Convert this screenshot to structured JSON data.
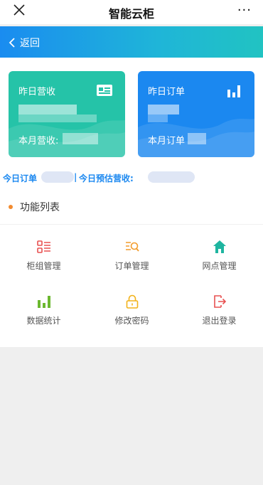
{
  "app": {
    "title": "智能云柜",
    "more": "···"
  },
  "nav": {
    "back_label": "返回"
  },
  "cards": [
    {
      "label": "昨日营收",
      "month_label": "本月营收:"
    },
    {
      "label": "昨日订单",
      "month_label": "本月订单"
    }
  ],
  "summary": {
    "today_orders_label": "今日订单",
    "separator": "|",
    "today_revenue_label": "今日预估营收:"
  },
  "section": {
    "title": "功能列表"
  },
  "menu": [
    {
      "label": "柜组管理",
      "icon": "list-icon",
      "color": "#e85050"
    },
    {
      "label": "订单管理",
      "icon": "search-list-icon",
      "color": "#f39c2b"
    },
    {
      "label": "网点管理",
      "icon": "home-icon",
      "color": "#1fb5a0"
    },
    {
      "label": "数据统计",
      "icon": "bar-chart-icon",
      "color": "#6bb82f"
    },
    {
      "label": "修改密码",
      "icon": "lock-icon",
      "color": "#f2b21a"
    },
    {
      "label": "退出登录",
      "icon": "logout-icon",
      "color": "#e85050"
    }
  ],
  "colors": {
    "green_card": "#25c3a8",
    "blue_card": "#1b88f0",
    "accent": "#1b88f0",
    "dot": "#f28b2f"
  }
}
